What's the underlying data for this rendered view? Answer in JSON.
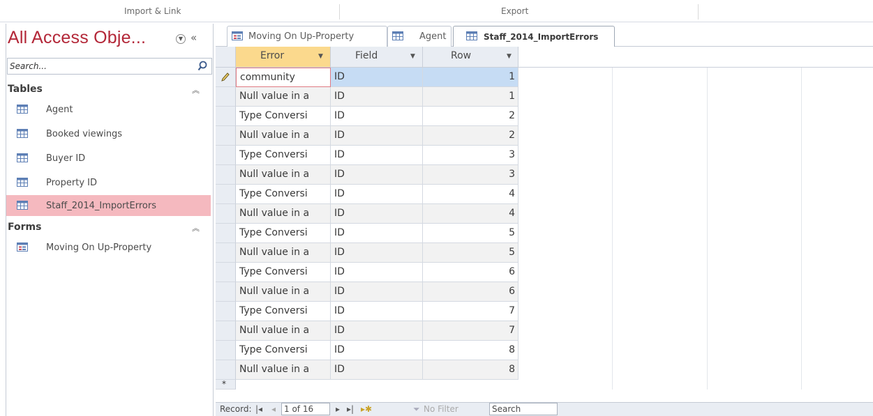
{
  "ribbon": {
    "import_label": "Import & Link",
    "export_label": "Export"
  },
  "nav": {
    "title": "All Access Obje...",
    "search_placeholder": "Search...",
    "groups": [
      {
        "label": "Tables",
        "items": [
          "Agent",
          "Booked viewings",
          "Buyer ID",
          "Property ID",
          "Staff_2014_ImportErrors"
        ]
      },
      {
        "label": "Forms",
        "items": [
          "Moving On Up-Property"
        ]
      }
    ],
    "selected_item": "Staff_2014_ImportErrors"
  },
  "tabs": [
    {
      "label": "Moving On Up-Property",
      "icon": "form-icon"
    },
    {
      "label": "Agent",
      "icon": "table-icon"
    },
    {
      "label": "Staff_2014_ImportErrors",
      "icon": "table-icon",
      "active": true
    }
  ],
  "datasheet": {
    "columns": [
      "Error",
      "Field",
      "Row"
    ],
    "rows": [
      {
        "error": "community",
        "field": "ID",
        "row": "1"
      },
      {
        "error": "Null value in a",
        "field": "ID",
        "row": "1"
      },
      {
        "error": "Type Conversi",
        "field": "ID",
        "row": "2"
      },
      {
        "error": "Null value in a",
        "field": "ID",
        "row": "2"
      },
      {
        "error": "Type Conversi",
        "field": "ID",
        "row": "3"
      },
      {
        "error": "Null value in a",
        "field": "ID",
        "row": "3"
      },
      {
        "error": "Type Conversi",
        "field": "ID",
        "row": "4"
      },
      {
        "error": "Null value in a",
        "field": "ID",
        "row": "4"
      },
      {
        "error": "Type Conversi",
        "field": "ID",
        "row": "5"
      },
      {
        "error": "Null value in a",
        "field": "ID",
        "row": "5"
      },
      {
        "error": "Type Conversi",
        "field": "ID",
        "row": "6"
      },
      {
        "error": "Null value in a",
        "field": "ID",
        "row": "6"
      },
      {
        "error": "Type Conversi",
        "field": "ID",
        "row": "7"
      },
      {
        "error": "Null value in a",
        "field": "ID",
        "row": "7"
      },
      {
        "error": "Type Conversi",
        "field": "ID",
        "row": "8"
      },
      {
        "error": "Null value in a",
        "field": "ID",
        "row": "8"
      }
    ],
    "new_record_marker": "*"
  },
  "record_nav": {
    "label": "Record:",
    "position": "1 of 16",
    "filter_label": "No Filter",
    "search_label": "Search"
  },
  "colors": {
    "nav_title": "#b32738",
    "selected_item": "#f5b9bf",
    "active_header": "#fbd98d",
    "current_cell": "#c6dcf4"
  }
}
